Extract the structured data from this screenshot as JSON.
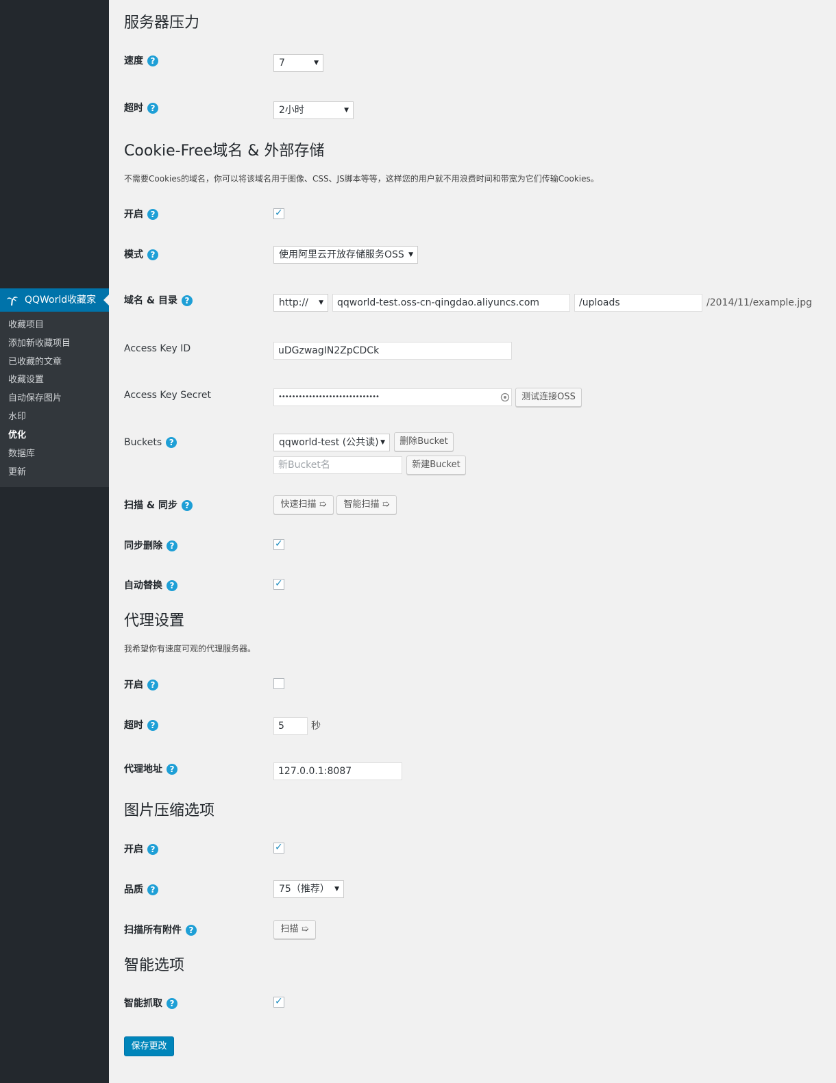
{
  "sidebar": {
    "menu_title": "QQWorld收藏家",
    "items": [
      "收藏项目",
      "添加新收藏项目",
      "已收藏的文章",
      "收藏设置",
      "自动保存图片",
      "水印",
      "优化",
      "数据库",
      "更新"
    ],
    "current_item": "优化"
  },
  "sections": {
    "server": {
      "title": "服务器压力",
      "speed_label": "速度",
      "speed_value": "7",
      "timeout_label": "超时",
      "timeout_value": "2小时"
    },
    "cookie_free": {
      "title": "Cookie-Free域名 & 外部存储",
      "description": "不需要Cookies的域名，你可以将该域名用于图像、CSS、JS脚本等等，这样您的用户就不用浪费时间和带宽为它们传输Cookies。",
      "enable_label": "开启",
      "mode_label": "模式",
      "mode_value": "使用阿里云开放存储服务OSS",
      "domain_label": "域名 & 目录",
      "protocol_value": "http://",
      "domain_value": "qqworld-test.oss-cn-qingdao.aliyuncs.com",
      "dir_value": "/uploads",
      "path_example": "/2014/11/example.jpg",
      "access_key_id_label": "Access Key ID",
      "access_key_id_value": "uDGzwagIN2ZpCDCk",
      "access_key_secret_label": "Access Key Secret",
      "access_key_secret_value": "••••••••••••••••••••••••••••••",
      "test_button": "测试连接OSS",
      "buckets_label": "Buckets",
      "bucket_value": "qqworld-test (公共读)",
      "delete_bucket_button": "删除Bucket",
      "new_bucket_placeholder": "新Bucket名",
      "new_bucket_button": "新建Bucket",
      "scan_sync_label": "扫描 & 同步",
      "quick_scan_button": "快速扫描 ➯",
      "smart_scan_button": "智能扫描 ➯",
      "sync_delete_label": "同步删除",
      "auto_replace_label": "自动替换"
    },
    "proxy": {
      "title": "代理设置",
      "description": "我希望你有速度可观的代理服务器。",
      "enable_label": "开启",
      "timeout_label": "超时",
      "timeout_value": "5",
      "timeout_unit": "秒",
      "address_label": "代理地址",
      "address_value": "127.0.0.1:8087"
    },
    "compress": {
      "title": "图片压缩选项",
      "enable_label": "开启",
      "quality_label": "品质",
      "quality_value": "75（推荐）",
      "scan_all_label": "扫描所有附件",
      "scan_button": "扫描 ➯"
    },
    "smart": {
      "title": "智能选项",
      "grab_label": "智能抓取"
    }
  },
  "save_button": "保存更改",
  "checkbox_states": {
    "cookie_enable": true,
    "sync_delete": true,
    "auto_replace": true,
    "proxy_enable": false,
    "compress_enable": true,
    "smart_grab": true
  },
  "colors": {
    "sidebar_bg": "#23282d",
    "submenu_bg": "#32373c",
    "accent": "#0073aa",
    "help_icon": "#1e9fd6",
    "primary_button": "#0085ba"
  },
  "icons": {
    "menu_icon": "palm-tree-icon",
    "help": "help-icon",
    "select_caret": "caret-down-icon",
    "checkmark": "check-icon",
    "reveal": "reveal-password-icon"
  }
}
